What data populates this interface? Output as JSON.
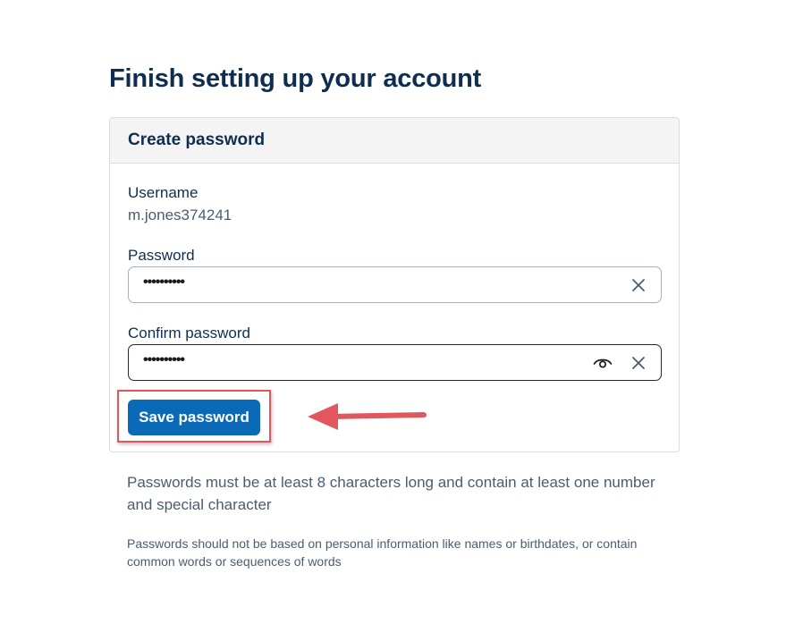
{
  "page": {
    "title": "Finish setting up your account"
  },
  "card": {
    "title": "Create password",
    "username_label": "Username",
    "username_value": "m.jones374241",
    "password_label": "Password",
    "password_value": "••••••••••",
    "confirm_label": "Confirm password",
    "confirm_value": "••••••••••",
    "save_label": "Save password"
  },
  "notes": {
    "requirements": "Passwords must be at least 8 characters long and contain at least one number and special character",
    "advice": "Passwords should not be based on personal information like names or birthdates, or contain common words or sequences of words"
  },
  "icons": {
    "clear_password": "close-icon",
    "show_confirm": "eye-icon",
    "clear_confirm": "close-icon",
    "annotation_arrow": "arrow-left-icon"
  },
  "colors": {
    "heading": "#0f2e4f",
    "primary_button": "#0a6ab8",
    "annotation": "#e0585b",
    "muted_text": "#4a5d70"
  }
}
